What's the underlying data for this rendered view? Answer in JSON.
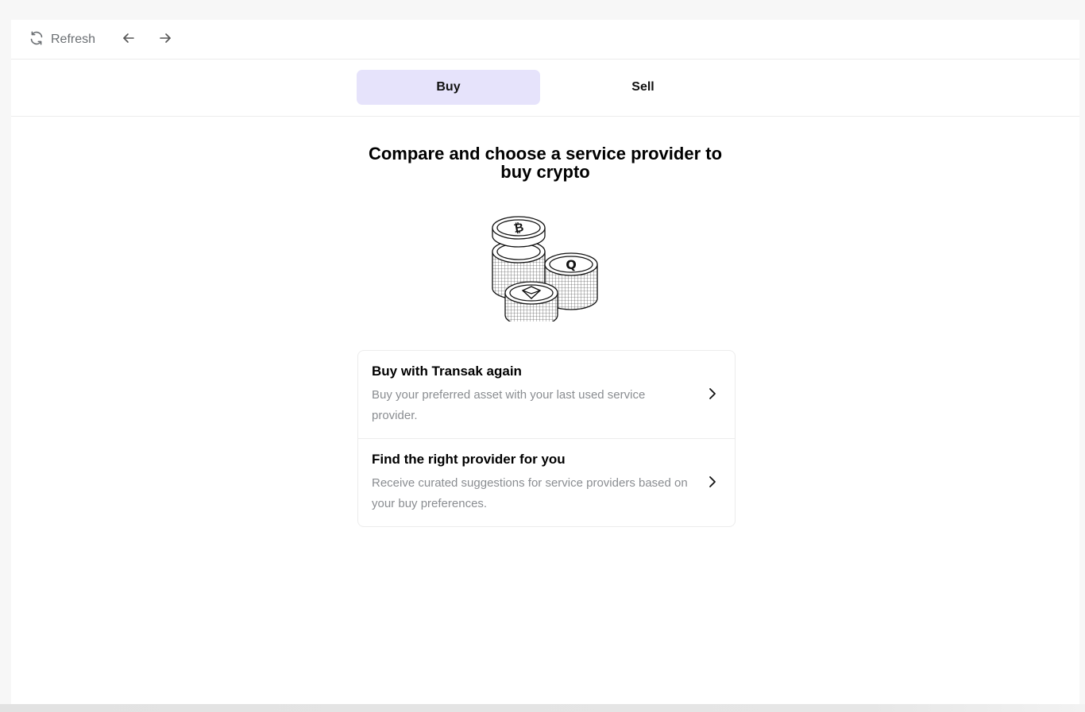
{
  "toolbar": {
    "refresh_label": "Refresh",
    "refresh_icon": "refresh-icon",
    "back_icon": "arrow-left-icon",
    "forward_icon": "arrow-right-icon"
  },
  "tabs": [
    {
      "label": "Buy",
      "selected": true
    },
    {
      "label": "Sell",
      "selected": false
    }
  ],
  "main": {
    "heading_line1": "Compare and choose a service provider to",
    "heading_line2": "buy crypto",
    "illustration": "crypto-coins-illustration",
    "options": [
      {
        "title": "Buy with Transak again",
        "description": "Buy your preferred asset with your last used service provider.",
        "icon": "chevron-right-icon"
      },
      {
        "title": "Find the right provider for you",
        "description": "Receive curated suggestions for service providers based on your buy preferences.",
        "icon": "chevron-right-icon"
      }
    ]
  },
  "colors": {
    "selected_tab_bg": "#e6e3fb",
    "muted_text": "#8a8d91",
    "toolbar_text": "#6b6f73",
    "border": "#ececec"
  }
}
